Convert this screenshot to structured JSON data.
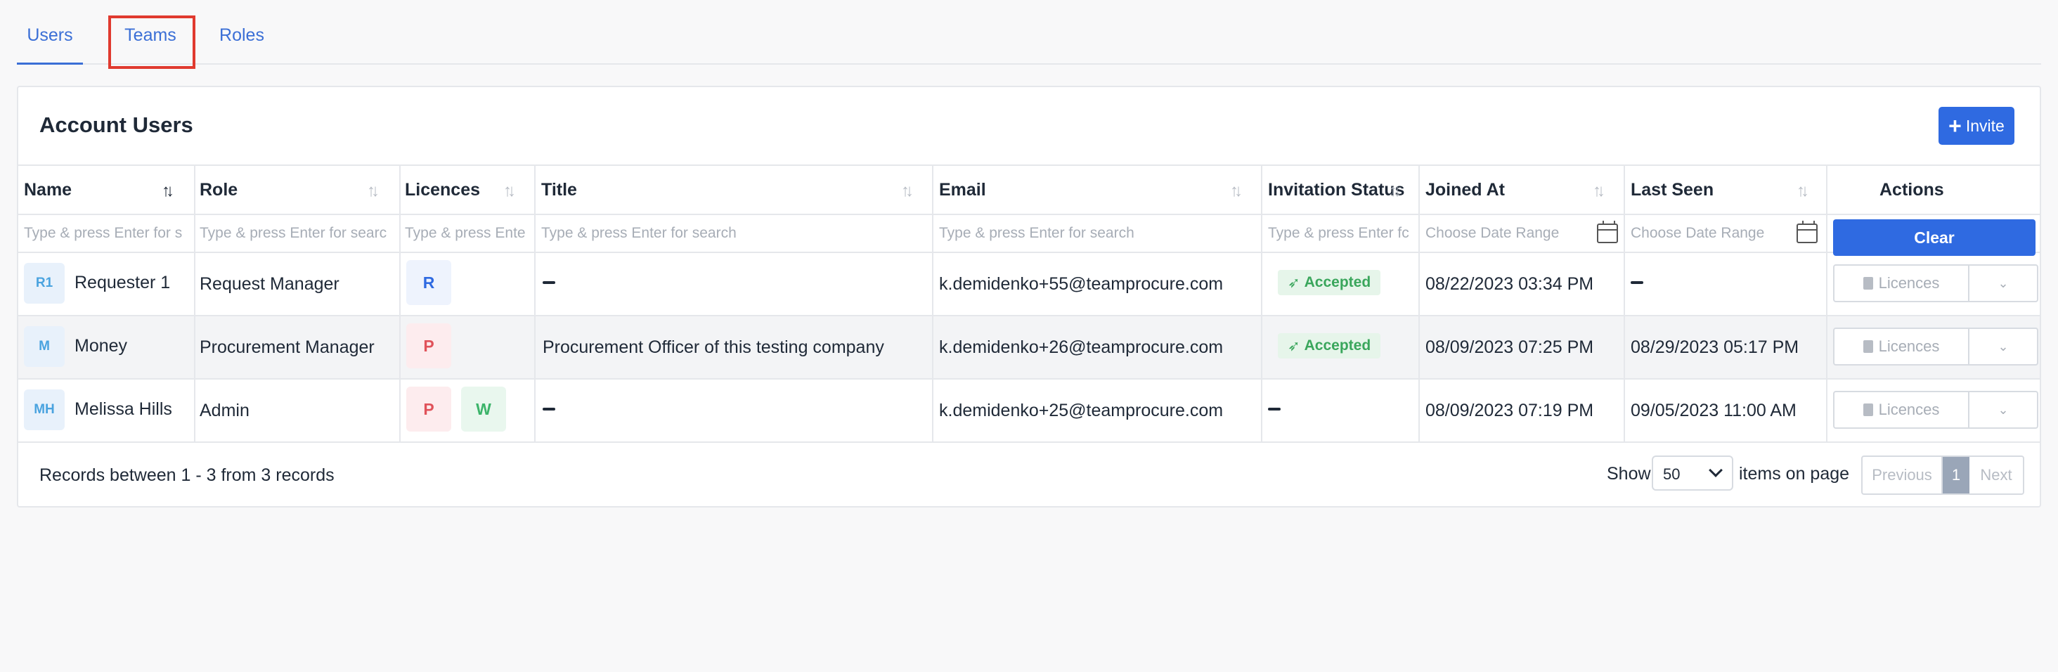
{
  "tabs": {
    "users": "Users",
    "teams": "Teams",
    "roles": "Roles"
  },
  "card": {
    "title": "Account Users",
    "invite_label": "Invite"
  },
  "table": {
    "headers": {
      "name": "Name",
      "role": "Role",
      "licences": "Licences",
      "title": "Title",
      "email": "Email",
      "invitation_status": "Invitation Status",
      "joined_at": "Joined At",
      "last_seen": "Last Seen",
      "actions": "Actions"
    },
    "filters": {
      "name": "Type & press Enter for s",
      "role": "Type & press Enter for searc",
      "licences": "Type & press Ente",
      "title": "Type & press Enter for search",
      "email": "Type & press Enter for search",
      "invitation_status": "Type & press Enter fc",
      "joined_at": "Choose Date Range",
      "last_seen": "Choose Date Range",
      "clear_label": "Clear"
    },
    "rows": [
      {
        "initials": "R1",
        "name": "Requester 1",
        "role": "Request Manager",
        "licences": [
          "R"
        ],
        "title": "",
        "email": "k.demidenko+55@teamprocure.com",
        "status": "Accepted",
        "joined_at": "08/22/2023 03:34 PM",
        "last_seen": "",
        "action_label": "Licences"
      },
      {
        "initials": "M",
        "name": "Money",
        "role": "Procurement Manager",
        "licences": [
          "P"
        ],
        "title": "Procurement Officer of this testing company",
        "email": "k.demidenko+26@teamprocure.com",
        "status": "Accepted",
        "joined_at": "08/09/2023 07:25 PM",
        "last_seen": "08/29/2023 05:17 PM",
        "action_label": "Licences"
      },
      {
        "initials": "MH",
        "name": "Melissa Hills",
        "role": "Admin",
        "licences": [
          "P",
          "W"
        ],
        "title": "",
        "email": "k.demidenko+25@teamprocure.com",
        "status": "",
        "joined_at": "08/09/2023 07:19 PM",
        "last_seen": "09/05/2023 11:00 AM",
        "action_label": "Licences"
      }
    ]
  },
  "footer": {
    "records_text": "Records between 1 - 3 from 3 records",
    "show_label": "Show",
    "page_size": "50",
    "items_label": "items on page",
    "prev_label": "Previous",
    "current_page": "1",
    "next_label": "Next"
  },
  "colors": {
    "accent": "#2f6ae1",
    "highlight_box": "#e03a2f",
    "accepted_bg": "#e6f5ea",
    "accepted_text": "#3aa65c"
  }
}
